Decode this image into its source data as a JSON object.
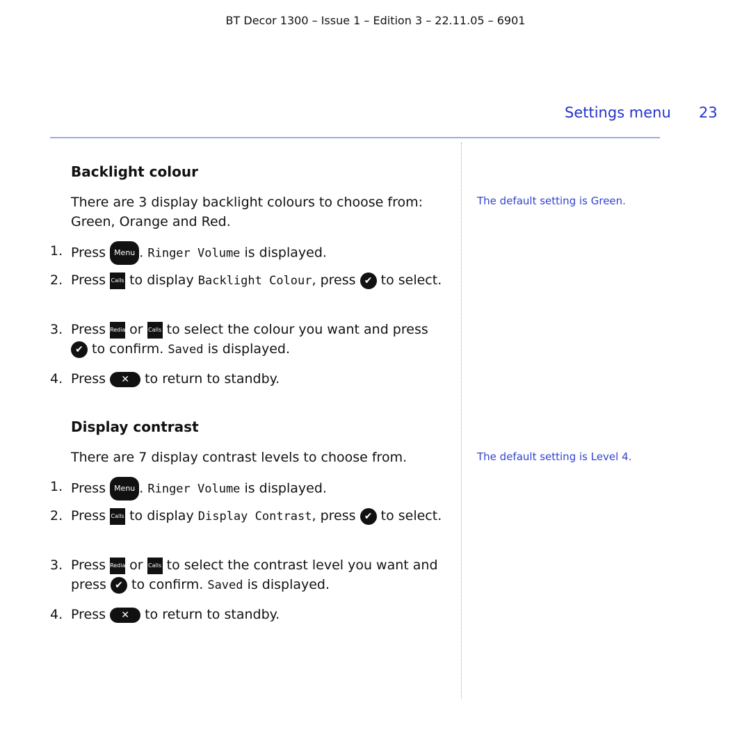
{
  "header": "BT Decor 1300 – Issue 1 – Edition 3 – 22.11.05 – 6901",
  "section": "Settings menu",
  "page": "23",
  "s1": {
    "title": "Backlight colour",
    "intro": "There are 3 display backlight colours to choose from: Green, Orange and Red.",
    "side": "The default setting is Green.",
    "lcd": "Backlight Colour",
    "target": "the colour you want and press"
  },
  "s2": {
    "title": "Display contrast",
    "intro": "There are 7 display contrast levels to choose from.",
    "side": "The default setting is Level 4.",
    "lcd": "Display Contrast",
    "target": "the contrast level you want and press"
  },
  "common": {
    "press": "Press",
    "menu": "Menu",
    "ringer": "Ringer Volume",
    "displayed": "is displayed.",
    "todisplay": "to display",
    "press2": ", press",
    "toselect": "to select.",
    "or": "or",
    "toselect2": "to select",
    "confirm": "to confirm.",
    "saved": "Saved",
    "standby": "to return to standby.",
    "calls": "Calls",
    "redial": "Redial",
    "check": "✔",
    "x": "✕"
  }
}
